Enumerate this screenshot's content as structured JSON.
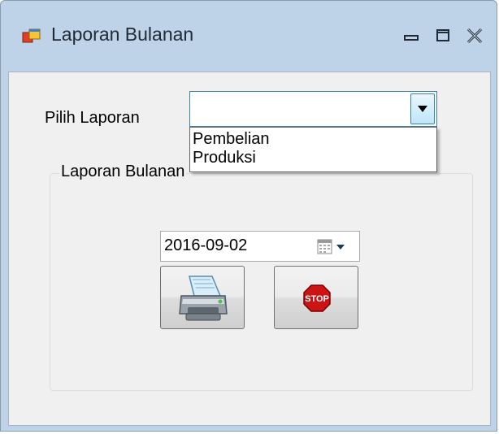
{
  "window": {
    "title": "Laporan Bulanan",
    "icons": {
      "app": "app-window-icon",
      "minimize": "minimize-icon",
      "maximize": "maximize-icon",
      "close": "close-icon"
    }
  },
  "form": {
    "pilih_label": "Pilih Laporan",
    "combo": {
      "value": "",
      "options": [
        "Pembelian",
        "Produksi"
      ]
    },
    "group": {
      "label": "Laporan Bulanan",
      "date_value": "2016-09-02",
      "print_icon": "printer-icon",
      "stop_icon": "stop-sign-icon",
      "stop_text": "STOP"
    }
  },
  "colors": {
    "titlebar": "#bed3e8",
    "client": "#f0f0f0",
    "accent": "#3c7fb1",
    "stop_red": "#cc1414"
  }
}
